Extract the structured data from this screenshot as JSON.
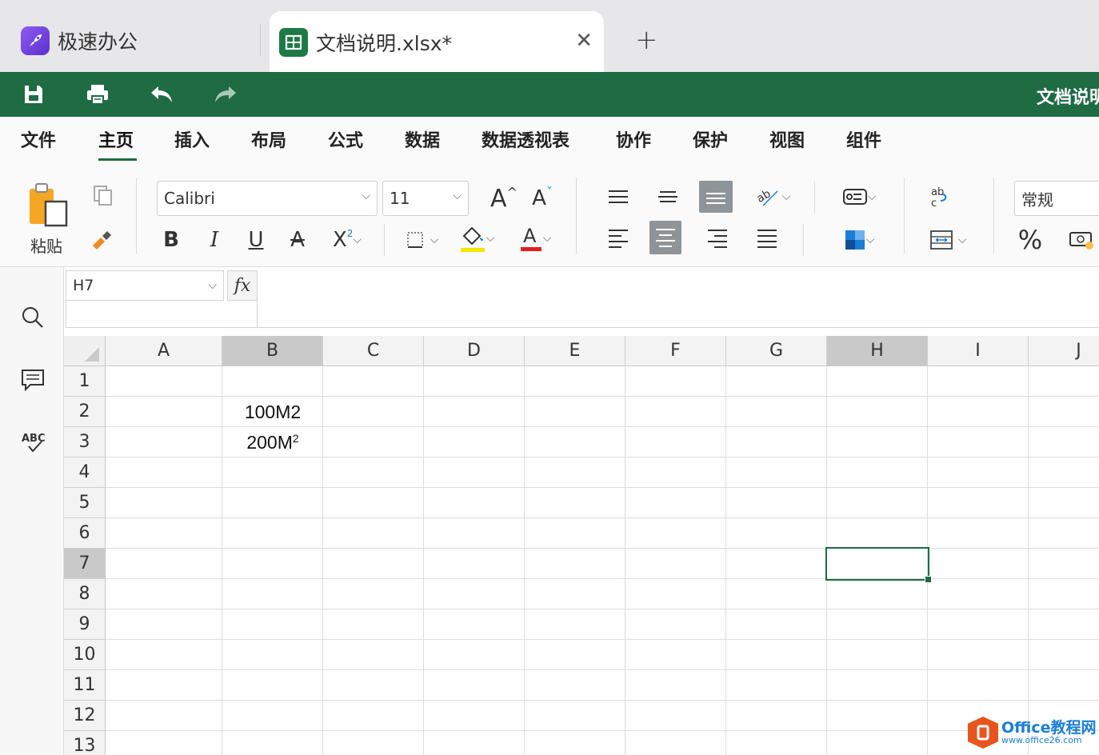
{
  "tabs": {
    "app_label": "极速办公",
    "doc_label": "文档说明.xlsx*",
    "close": "✕",
    "add": "+"
  },
  "quickbar": {
    "title": "文档说明"
  },
  "menu": [
    "文件",
    "主页",
    "插入",
    "布局",
    "公式",
    "数据",
    "数据透视表",
    "协作",
    "保护",
    "视图",
    "组件"
  ],
  "ribbon": {
    "paste_label": "粘贴",
    "font_name": "Calibri",
    "font_size": "11",
    "number_format": "常规",
    "percent": "%"
  },
  "formula": {
    "cell_ref": "H7",
    "fx": "fx"
  },
  "columns": [
    "A",
    "B",
    "C",
    "D",
    "E",
    "F",
    "G",
    "H",
    "I",
    "J"
  ],
  "rows": [
    "1",
    "2",
    "3",
    "4",
    "5",
    "6",
    "7",
    "8",
    "9",
    "10",
    "11",
    "12",
    "13"
  ],
  "cells": {
    "b2": "100M2",
    "b3_base": "200M",
    "b3_sup": "2"
  },
  "watermark": {
    "line1": "Office教程网",
    "line2": "www.office26.com"
  },
  "colors": {
    "accent": "#1e6b44",
    "selected_header": "#c9c9c9"
  }
}
